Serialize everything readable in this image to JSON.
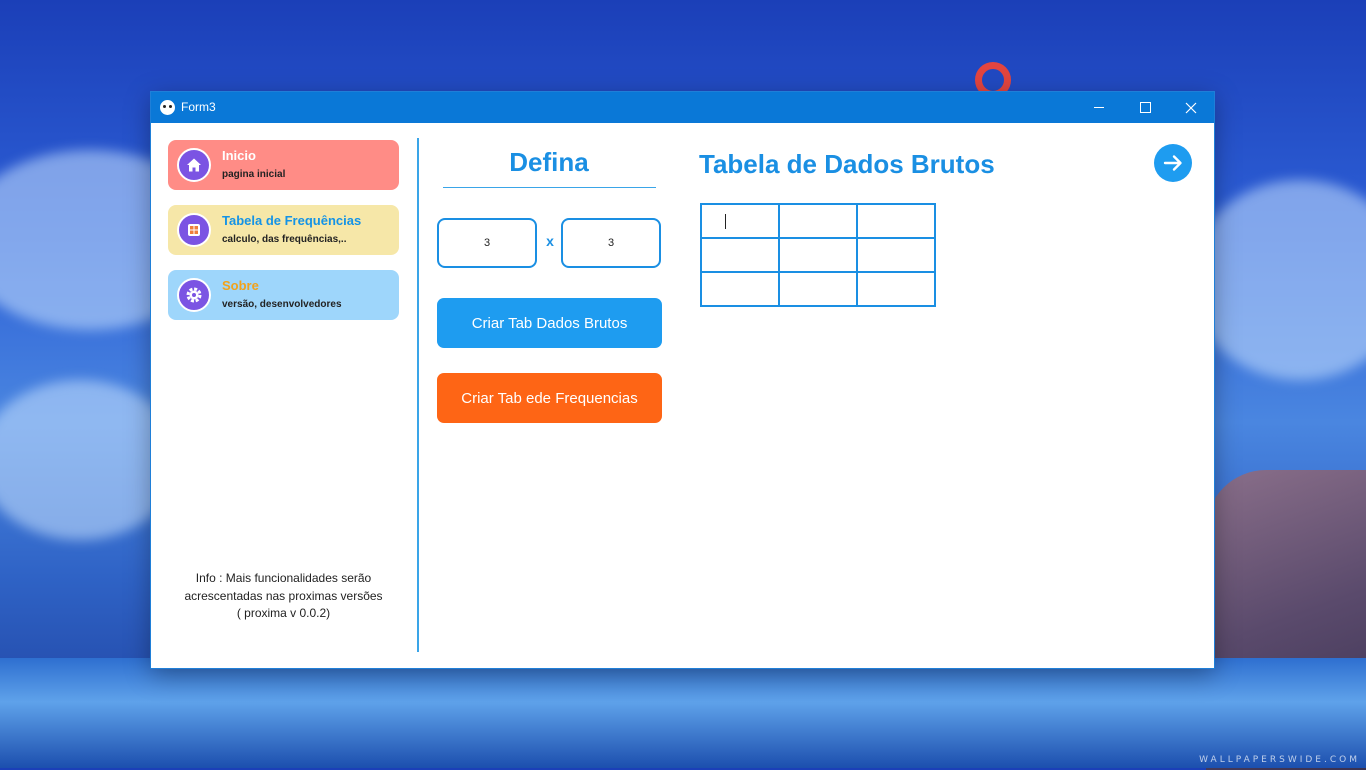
{
  "window": {
    "title": "Form3",
    "controls": {
      "minimize": "minimize-icon",
      "maximize": "maximize-icon",
      "close": "close-icon"
    }
  },
  "sidebar": {
    "items": [
      {
        "title": "Inicio",
        "subtitle": "pagina inicial",
        "icon": "home-icon",
        "color": "#ff8c86"
      },
      {
        "title": "Tabela de Frequências",
        "subtitle": "calculo, das frequências,..",
        "icon": "table-icon",
        "color": "#f6e7a8"
      },
      {
        "title": "Sobre",
        "subtitle": "versão, desenvolvedores",
        "icon": "gear-icon",
        "color": "#9ed6fb"
      }
    ],
    "info": [
      "Info : Mais funcionalidades serão",
      "acrescentadas nas proximas versões",
      "( proxima v 0.0.2)"
    ]
  },
  "define": {
    "title": "Defina",
    "rows": "3",
    "separator": "x",
    "cols": "3",
    "create_raw_button": "Criar Tab Dados Brutos",
    "create_freq_button": "Criar Tab ede Frequencias",
    "accent": "#1a8fe3",
    "orange": "#fe6515"
  },
  "raw_table": {
    "title": "Tabela de Dados Brutos",
    "next_icon": "arrow-right-icon",
    "cells": [
      [
        "",
        "",
        ""
      ],
      [
        "",
        "",
        ""
      ],
      [
        "",
        "",
        ""
      ]
    ]
  }
}
